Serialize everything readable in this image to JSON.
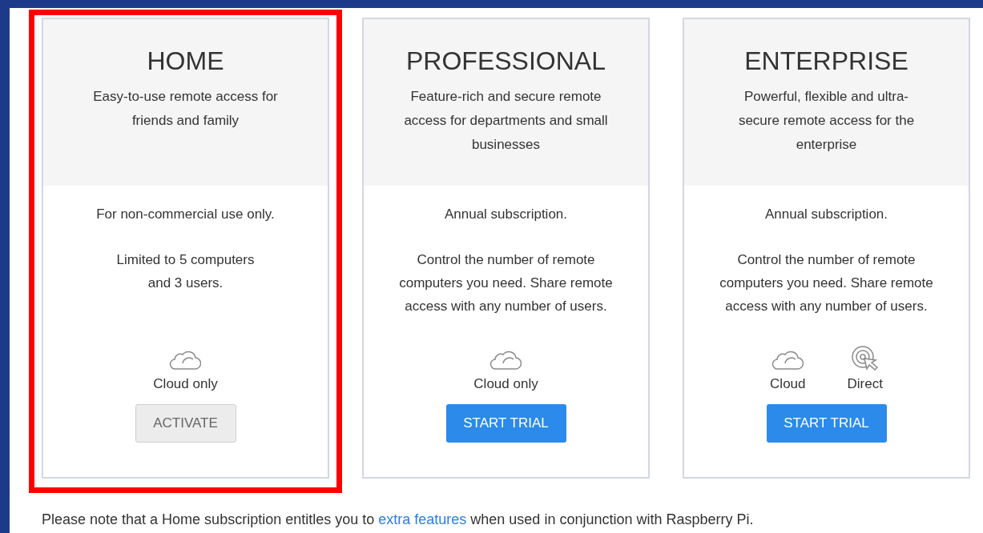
{
  "plans": [
    {
      "title": "HOME",
      "description": "Easy-to-use remote access for\nfriends and family",
      "notes": [
        "For non-commercial use only.",
        "Limited to 5 computers\nand 3 users."
      ],
      "options": [
        {
          "kind": "cloud",
          "label": "Cloud only"
        }
      ],
      "button": {
        "label": "ACTIVATE",
        "kind": "secondary"
      },
      "highlighted": true
    },
    {
      "title": "PROFESSIONAL",
      "description": "Feature-rich and secure remote\naccess for departments and small\nbusinesses",
      "notes": [
        "Annual subscription.",
        "Control the number of remote\ncomputers you need. Share remote\naccess with any number of users."
      ],
      "options": [
        {
          "kind": "cloud",
          "label": "Cloud only"
        }
      ],
      "button": {
        "label": "START TRIAL",
        "kind": "primary"
      },
      "highlighted": false
    },
    {
      "title": "ENTERPRISE",
      "description": "Powerful, flexible and ultra-\nsecure remote access for the\nenterprise",
      "notes": [
        "Annual subscription.",
        "Control the number of remote\ncomputers you need. Share remote\naccess with any number of users."
      ],
      "options": [
        {
          "kind": "cloud",
          "label": "Cloud"
        },
        {
          "kind": "direct",
          "label": "Direct"
        }
      ],
      "button": {
        "label": "START TRIAL",
        "kind": "primary"
      },
      "highlighted": false
    }
  ],
  "footnote": {
    "before": "Please note that a Home subscription entitles you to",
    "link": "extra features",
    "after": "when used in conjunction with Raspberry Pi."
  }
}
